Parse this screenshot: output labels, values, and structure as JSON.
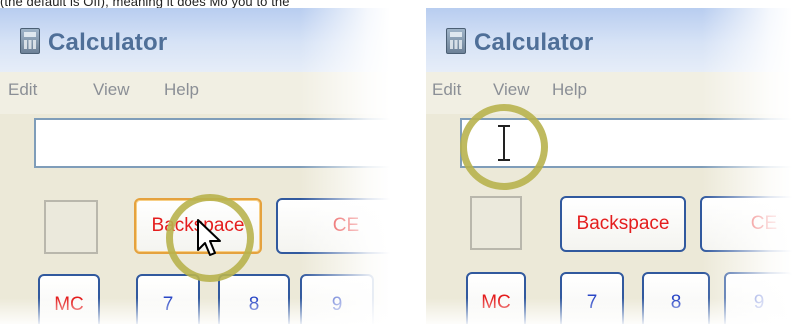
{
  "caption": "(the default is Off), meaning it does Mo you to the",
  "left_window": {
    "title": "Calculator",
    "menu": [
      "Edit",
      "View",
      "Help"
    ],
    "buttons": {
      "backspace": "Backspace",
      "ce": "CE",
      "mc": "MC",
      "seven": "7",
      "eight": "8",
      "nine": "9"
    },
    "cursor_icon": "arrow-pointer-icon",
    "highlight_color": "#b8b24e"
  },
  "right_window": {
    "title": "Calculator",
    "menu": [
      "Edit",
      "View",
      "Help"
    ],
    "buttons": {
      "backspace": "Backspace",
      "ce": "CE",
      "mc": "MC",
      "seven": "7",
      "eight": "8",
      "nine": "9"
    },
    "cursor_icon": "i-beam-icon",
    "highlight_color": "#b8b24e"
  }
}
